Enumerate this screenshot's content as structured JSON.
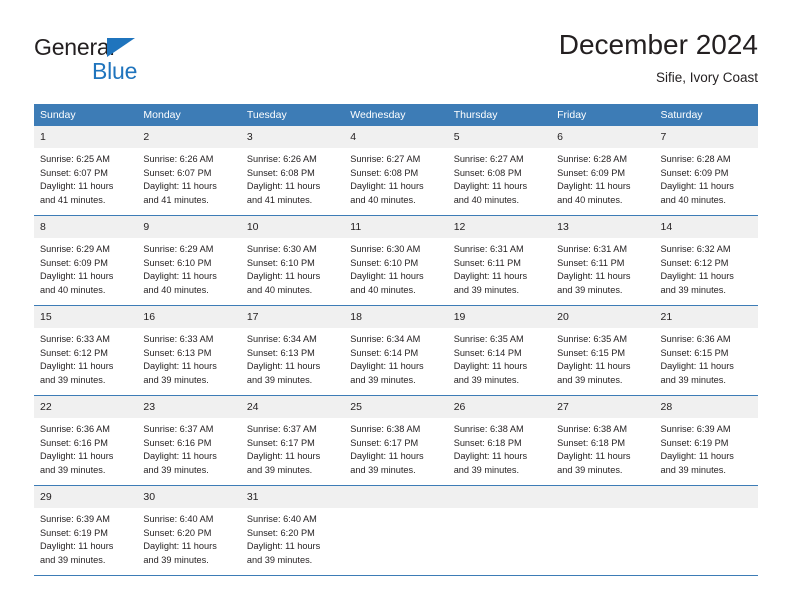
{
  "brand": {
    "name_part1": "General",
    "name_part2": "Blue",
    "triangle_icon": "brand-triangle-icon",
    "color_dark": "#231f20",
    "color_blue": "#1f74bd"
  },
  "header": {
    "title": "December 2024",
    "subtitle": "Sifie, Ivory Coast"
  },
  "theme": {
    "header_blue": "#3d7cb6",
    "daynum_band": "#f0f0f0",
    "text": "#231f20"
  },
  "calendar": {
    "weekday_headers": [
      "Sunday",
      "Monday",
      "Tuesday",
      "Wednesday",
      "Thursday",
      "Friday",
      "Saturday"
    ],
    "weeks": [
      [
        {
          "day": "1",
          "sunrise": "Sunrise: 6:25 AM",
          "sunset": "Sunset: 6:07 PM",
          "daylight_line1": "Daylight: 11 hours",
          "daylight_line2": "and 41 minutes."
        },
        {
          "day": "2",
          "sunrise": "Sunrise: 6:26 AM",
          "sunset": "Sunset: 6:07 PM",
          "daylight_line1": "Daylight: 11 hours",
          "daylight_line2": "and 41 minutes."
        },
        {
          "day": "3",
          "sunrise": "Sunrise: 6:26 AM",
          "sunset": "Sunset: 6:08 PM",
          "daylight_line1": "Daylight: 11 hours",
          "daylight_line2": "and 41 minutes."
        },
        {
          "day": "4",
          "sunrise": "Sunrise: 6:27 AM",
          "sunset": "Sunset: 6:08 PM",
          "daylight_line1": "Daylight: 11 hours",
          "daylight_line2": "and 40 minutes."
        },
        {
          "day": "5",
          "sunrise": "Sunrise: 6:27 AM",
          "sunset": "Sunset: 6:08 PM",
          "daylight_line1": "Daylight: 11 hours",
          "daylight_line2": "and 40 minutes."
        },
        {
          "day": "6",
          "sunrise": "Sunrise: 6:28 AM",
          "sunset": "Sunset: 6:09 PM",
          "daylight_line1": "Daylight: 11 hours",
          "daylight_line2": "and 40 minutes."
        },
        {
          "day": "7",
          "sunrise": "Sunrise: 6:28 AM",
          "sunset": "Sunset: 6:09 PM",
          "daylight_line1": "Daylight: 11 hours",
          "daylight_line2": "and 40 minutes."
        }
      ],
      [
        {
          "day": "8",
          "sunrise": "Sunrise: 6:29 AM",
          "sunset": "Sunset: 6:09 PM",
          "daylight_line1": "Daylight: 11 hours",
          "daylight_line2": "and 40 minutes."
        },
        {
          "day": "9",
          "sunrise": "Sunrise: 6:29 AM",
          "sunset": "Sunset: 6:10 PM",
          "daylight_line1": "Daylight: 11 hours",
          "daylight_line2": "and 40 minutes."
        },
        {
          "day": "10",
          "sunrise": "Sunrise: 6:30 AM",
          "sunset": "Sunset: 6:10 PM",
          "daylight_line1": "Daylight: 11 hours",
          "daylight_line2": "and 40 minutes."
        },
        {
          "day": "11",
          "sunrise": "Sunrise: 6:30 AM",
          "sunset": "Sunset: 6:10 PM",
          "daylight_line1": "Daylight: 11 hours",
          "daylight_line2": "and 40 minutes."
        },
        {
          "day": "12",
          "sunrise": "Sunrise: 6:31 AM",
          "sunset": "Sunset: 6:11 PM",
          "daylight_line1": "Daylight: 11 hours",
          "daylight_line2": "and 39 minutes."
        },
        {
          "day": "13",
          "sunrise": "Sunrise: 6:31 AM",
          "sunset": "Sunset: 6:11 PM",
          "daylight_line1": "Daylight: 11 hours",
          "daylight_line2": "and 39 minutes."
        },
        {
          "day": "14",
          "sunrise": "Sunrise: 6:32 AM",
          "sunset": "Sunset: 6:12 PM",
          "daylight_line1": "Daylight: 11 hours",
          "daylight_line2": "and 39 minutes."
        }
      ],
      [
        {
          "day": "15",
          "sunrise": "Sunrise: 6:33 AM",
          "sunset": "Sunset: 6:12 PM",
          "daylight_line1": "Daylight: 11 hours",
          "daylight_line2": "and 39 minutes."
        },
        {
          "day": "16",
          "sunrise": "Sunrise: 6:33 AM",
          "sunset": "Sunset: 6:13 PM",
          "daylight_line1": "Daylight: 11 hours",
          "daylight_line2": "and 39 minutes."
        },
        {
          "day": "17",
          "sunrise": "Sunrise: 6:34 AM",
          "sunset": "Sunset: 6:13 PM",
          "daylight_line1": "Daylight: 11 hours",
          "daylight_line2": "and 39 minutes."
        },
        {
          "day": "18",
          "sunrise": "Sunrise: 6:34 AM",
          "sunset": "Sunset: 6:14 PM",
          "daylight_line1": "Daylight: 11 hours",
          "daylight_line2": "and 39 minutes."
        },
        {
          "day": "19",
          "sunrise": "Sunrise: 6:35 AM",
          "sunset": "Sunset: 6:14 PM",
          "daylight_line1": "Daylight: 11 hours",
          "daylight_line2": "and 39 minutes."
        },
        {
          "day": "20",
          "sunrise": "Sunrise: 6:35 AM",
          "sunset": "Sunset: 6:15 PM",
          "daylight_line1": "Daylight: 11 hours",
          "daylight_line2": "and 39 minutes."
        },
        {
          "day": "21",
          "sunrise": "Sunrise: 6:36 AM",
          "sunset": "Sunset: 6:15 PM",
          "daylight_line1": "Daylight: 11 hours",
          "daylight_line2": "and 39 minutes."
        }
      ],
      [
        {
          "day": "22",
          "sunrise": "Sunrise: 6:36 AM",
          "sunset": "Sunset: 6:16 PM",
          "daylight_line1": "Daylight: 11 hours",
          "daylight_line2": "and 39 minutes."
        },
        {
          "day": "23",
          "sunrise": "Sunrise: 6:37 AM",
          "sunset": "Sunset: 6:16 PM",
          "daylight_line1": "Daylight: 11 hours",
          "daylight_line2": "and 39 minutes."
        },
        {
          "day": "24",
          "sunrise": "Sunrise: 6:37 AM",
          "sunset": "Sunset: 6:17 PM",
          "daylight_line1": "Daylight: 11 hours",
          "daylight_line2": "and 39 minutes."
        },
        {
          "day": "25",
          "sunrise": "Sunrise: 6:38 AM",
          "sunset": "Sunset: 6:17 PM",
          "daylight_line1": "Daylight: 11 hours",
          "daylight_line2": "and 39 minutes."
        },
        {
          "day": "26",
          "sunrise": "Sunrise: 6:38 AM",
          "sunset": "Sunset: 6:18 PM",
          "daylight_line1": "Daylight: 11 hours",
          "daylight_line2": "and 39 minutes."
        },
        {
          "day": "27",
          "sunrise": "Sunrise: 6:38 AM",
          "sunset": "Sunset: 6:18 PM",
          "daylight_line1": "Daylight: 11 hours",
          "daylight_line2": "and 39 minutes."
        },
        {
          "day": "28",
          "sunrise": "Sunrise: 6:39 AM",
          "sunset": "Sunset: 6:19 PM",
          "daylight_line1": "Daylight: 11 hours",
          "daylight_line2": "and 39 minutes."
        }
      ],
      [
        {
          "day": "29",
          "sunrise": "Sunrise: 6:39 AM",
          "sunset": "Sunset: 6:19 PM",
          "daylight_line1": "Daylight: 11 hours",
          "daylight_line2": "and 39 minutes."
        },
        {
          "day": "30",
          "sunrise": "Sunrise: 6:40 AM",
          "sunset": "Sunset: 6:20 PM",
          "daylight_line1": "Daylight: 11 hours",
          "daylight_line2": "and 39 minutes."
        },
        {
          "day": "31",
          "sunrise": "Sunrise: 6:40 AM",
          "sunset": "Sunset: 6:20 PM",
          "daylight_line1": "Daylight: 11 hours",
          "daylight_line2": "and 39 minutes."
        },
        {
          "day": "",
          "sunrise": "",
          "sunset": "",
          "daylight_line1": "",
          "daylight_line2": ""
        },
        {
          "day": "",
          "sunrise": "",
          "sunset": "",
          "daylight_line1": "",
          "daylight_line2": ""
        },
        {
          "day": "",
          "sunrise": "",
          "sunset": "",
          "daylight_line1": "",
          "daylight_line2": ""
        },
        {
          "day": "",
          "sunrise": "",
          "sunset": "",
          "daylight_line1": "",
          "daylight_line2": ""
        }
      ]
    ]
  }
}
